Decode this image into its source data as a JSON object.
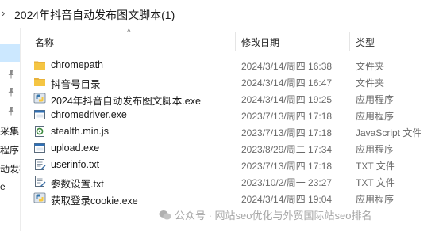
{
  "address_bar": {
    "chevron": "›",
    "path": "2024年抖音自动发布图文脚本(1)"
  },
  "sidebar": {
    "partial_labels": [
      "采集",
      "程序",
      "动发布",
      "e"
    ]
  },
  "columns": {
    "name": "名称",
    "date": "修改日期",
    "type": "类型",
    "sort_indicator": "^"
  },
  "files": [
    {
      "name": "chromepath",
      "date": "2024/3/14/周四 16:38",
      "type": "文件夹",
      "icon": "folder-icon"
    },
    {
      "name": "抖音号目录",
      "date": "2024/3/14/周四 16:47",
      "type": "文件夹",
      "icon": "folder-icon"
    },
    {
      "name": "2024年抖音自动发布图文脚本.exe",
      "date": "2024/3/14/周四 19:25",
      "type": "应用程序",
      "icon": "python-exe-icon"
    },
    {
      "name": "chromedriver.exe",
      "date": "2023/7/13/周四 17:18",
      "type": "应用程序",
      "icon": "exe-window-icon"
    },
    {
      "name": "stealth.min.js",
      "date": "2023/7/13/周四 17:18",
      "type": "JavaScript 文件",
      "icon": "js-file-icon"
    },
    {
      "name": "upload.exe",
      "date": "2023/8/29/周二 17:34",
      "type": "应用程序",
      "icon": "exe-window-icon"
    },
    {
      "name": "userinfo.txt",
      "date": "2023/7/13/周四 17:18",
      "type": "TXT 文件",
      "icon": "txt-file-icon"
    },
    {
      "name": "参数设置.txt",
      "date": "2023/10/2/周一 23:27",
      "type": "TXT 文件",
      "icon": "txt-file-icon"
    },
    {
      "name": "获取登录cookie.exe",
      "date": "2024/3/14/周四 19:04",
      "type": "应用程序",
      "icon": "python-exe-icon"
    }
  ],
  "watermark": {
    "text": "公众号 · 网站seo优化与外贸国际站seo排名"
  },
  "colors": {
    "selection": "#cce8ff",
    "folder": "#f5c542",
    "muted_text": "#6a6a6a"
  }
}
